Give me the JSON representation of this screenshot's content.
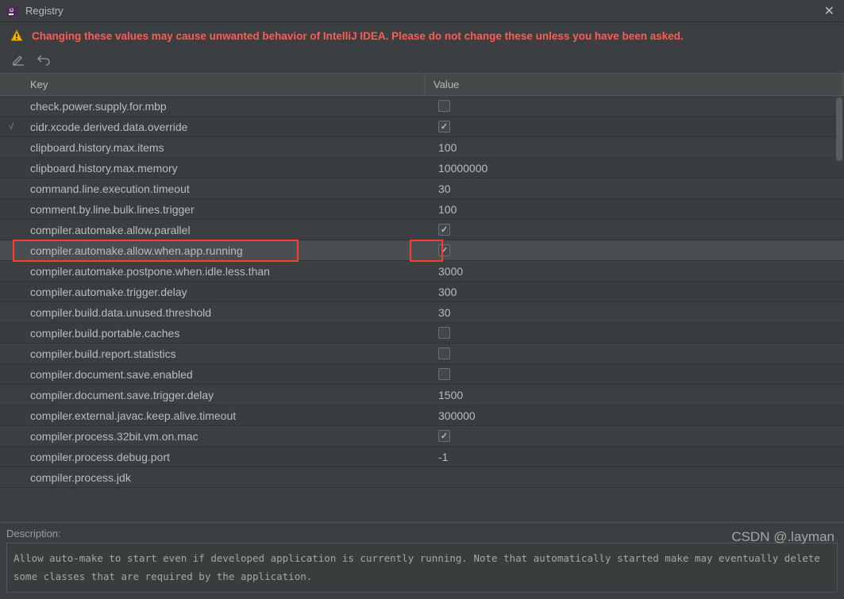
{
  "window": {
    "title": "Registry"
  },
  "warning": {
    "text": "Changing these values may cause unwanted behavior of IntelliJ IDEA. Please do not change these unless you have been asked."
  },
  "columns": {
    "key": "Key",
    "value": "Value"
  },
  "rows": [
    {
      "marker": "",
      "key": "check.power.supply.for.mbp",
      "type": "checkbox",
      "checked": false
    },
    {
      "marker": "√",
      "key": "cidr.xcode.derived.data.override",
      "type": "checkbox",
      "checked": true
    },
    {
      "marker": "",
      "key": "clipboard.history.max.items",
      "type": "text",
      "value": "100"
    },
    {
      "marker": "",
      "key": "clipboard.history.max.memory",
      "type": "text",
      "value": "10000000"
    },
    {
      "marker": "",
      "key": "command.line.execution.timeout",
      "type": "text",
      "value": "30"
    },
    {
      "marker": "",
      "key": "comment.by.line.bulk.lines.trigger",
      "type": "text",
      "value": "100"
    },
    {
      "marker": "",
      "key": "compiler.automake.allow.parallel",
      "type": "checkbox",
      "checked": true
    },
    {
      "marker": "",
      "key": "compiler.automake.allow.when.app.running",
      "type": "checkbox",
      "checked": true,
      "highlight": true,
      "selected": true
    },
    {
      "marker": "",
      "key": "compiler.automake.postpone.when.idle.less.than",
      "type": "text",
      "value": "3000"
    },
    {
      "marker": "",
      "key": "compiler.automake.trigger.delay",
      "type": "text",
      "value": "300"
    },
    {
      "marker": "",
      "key": "compiler.build.data.unused.threshold",
      "type": "text",
      "value": "30"
    },
    {
      "marker": "",
      "key": "compiler.build.portable.caches",
      "type": "checkbox",
      "checked": false
    },
    {
      "marker": "",
      "key": "compiler.build.report.statistics",
      "type": "checkbox",
      "checked": false
    },
    {
      "marker": "",
      "key": "compiler.document.save.enabled",
      "type": "checkbox",
      "checked": false
    },
    {
      "marker": "",
      "key": "compiler.document.save.trigger.delay",
      "type": "text",
      "value": "1500"
    },
    {
      "marker": "",
      "key": "compiler.external.javac.keep.alive.timeout",
      "type": "text",
      "value": "300000"
    },
    {
      "marker": "",
      "key": "compiler.process.32bit.vm.on.mac",
      "type": "checkbox",
      "checked": true
    },
    {
      "marker": "",
      "key": "compiler.process.debug.port",
      "type": "text",
      "value": "-1"
    },
    {
      "marker": "",
      "key": "compiler.process.jdk",
      "type": "text",
      "value": ""
    }
  ],
  "description": {
    "label": "Description:",
    "text": "Allow auto-make to start even if developed application is currently running. Note that automatically started make may eventually delete some classes that are required by the application."
  },
  "watermark": "CSDN @.layman"
}
